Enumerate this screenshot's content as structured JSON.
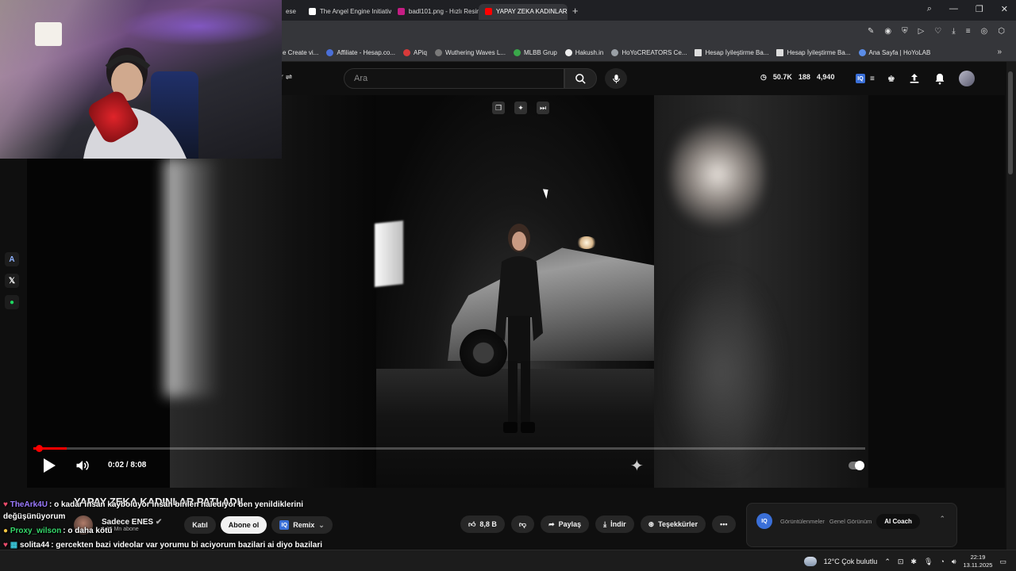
{
  "browser": {
    "tabs": [
      {
        "label": "ese",
        "color": "#5a5a5a",
        "active": false
      },
      {
        "label": "The Angel Engine Initiativ",
        "color": "#ffffff",
        "active": false
      },
      {
        "label": "badl101.png - Hızlı Resim",
        "color": "#c51d84",
        "active": false
      },
      {
        "label": "YAPAY ZEKA KADINLAR P",
        "color": "#ff0000",
        "active": true
      }
    ],
    "new_tab": "+",
    "bookmarks": [
      {
        "label": "e Create vi..."
      },
      {
        "label": "Affiliate - Hesap.co..."
      },
      {
        "label": "APiq"
      },
      {
        "label": "Wuthering Waves L..."
      },
      {
        "label": "MLBB Grup"
      },
      {
        "label": "Hakush.in"
      },
      {
        "label": "HoYoCREATORS Ce..."
      },
      {
        "label": "Hesap İyileştirme Ba..."
      },
      {
        "label": "Hesap İyileştirme Ba..."
      },
      {
        "label": "Ana Sayfa | HoYoLAB"
      }
    ],
    "bookmarks_more": "»"
  },
  "youtube": {
    "search_placeholder": "Ara",
    "filter_label": "er",
    "stats": {
      "views": "50.7K",
      "count2": "188",
      "count3": "4,940"
    },
    "video": {
      "current_time": "0:02 / 8:08",
      "progress": 0.004
    },
    "title": "YAPAY ZEKA KADINLAR PATLADI!",
    "channel": {
      "name": "Sadece ENES",
      "subs": "1,16 Mn abone"
    },
    "buttons": {
      "join": "Katıl",
      "subscribe": "Abone ol",
      "remix": "Remix",
      "likes": "8,8 B",
      "share": "Paylaş",
      "download": "İndir",
      "thanks": "Teşekkürler",
      "more": "•••"
    },
    "ai_panel": {
      "logo": "IQ",
      "tab1": "Görüntülenmeler",
      "tab2": "Genel Görünüm",
      "tab3": "AI Coach"
    }
  },
  "chat": [
    {
      "user": "TheArk4U",
      "user_color": "#9b7bff",
      "message": ": o kadar insan kayboluyor insan birilen haledıyor ben yenildiklerini değüşünüyorum"
    },
    {
      "user": "Proxy_wilson",
      "user_color": "#36d96b",
      "message": ": o daha kötü"
    },
    {
      "user": "solita44",
      "user_color": "#ffffff",
      "message": ": gercekten bazi videolar var yorumu bi aciyorum bazilari ai diyo bazilari gercek diyo algilarimizla oynaniyomus gibi hissediyorun"
    }
  ],
  "taskbar": {
    "weather": "12°C  Çok bulutlu",
    "time": "22:19",
    "date": "13.11.2025"
  }
}
